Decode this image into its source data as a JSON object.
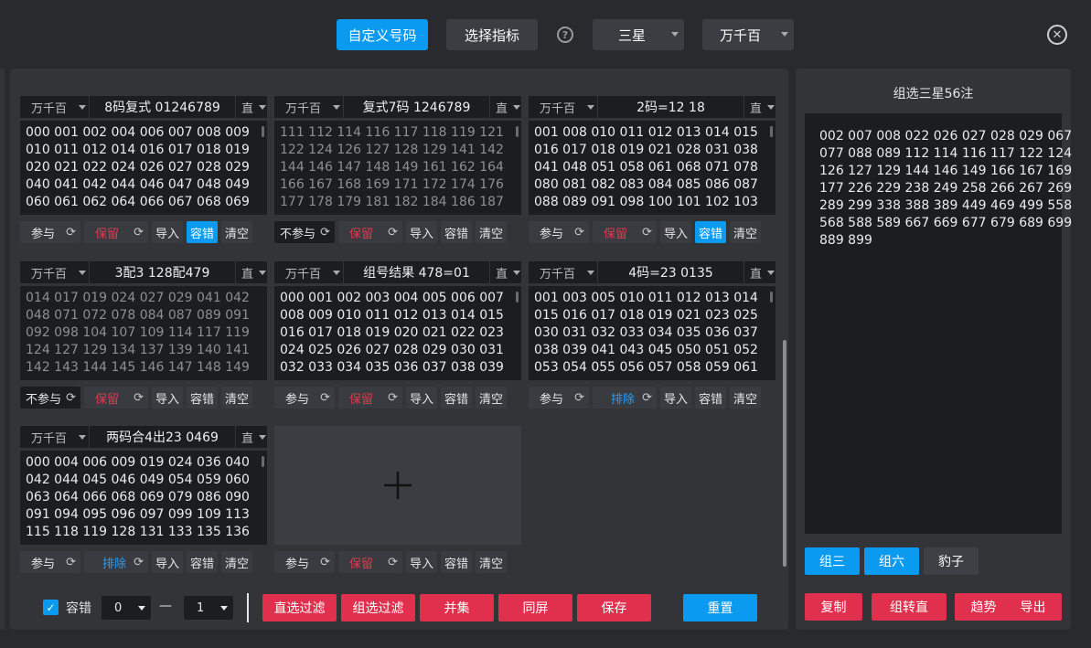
{
  "toolbar": {
    "custom_button": "自定义号码",
    "indicator_button": "选择指标",
    "help_icon": "?",
    "star_select": "三星",
    "position_select": "万千百"
  },
  "panels": [
    {
      "position": "万千百",
      "title": "8码复式 01246789",
      "mode": "直",
      "lines": [
        "000 001 002 004 006 007 008 009",
        "010 011 012 014 016 017 018 019",
        "020 021 022 024 026 027 028 029",
        "040 041 042 044 046 047 048 049",
        "060 061 062 064 066 067 068 069"
      ],
      "participate": "参与",
      "keep": "保留",
      "import": "导入",
      "tolerance": "容错",
      "clear": "清空"
    },
    {
      "position": "万千百",
      "title": "复式7码 1246789",
      "mode": "直",
      "lines": [
        "111 112 114 116 117 118 119 121",
        "122 124 126 127 128 129 141 142",
        "144 146 147 148 149 161 162 164",
        "166 167 168 169 171 172 174 176",
        "177 178 179 181 182 184 186 187"
      ],
      "participate": "不参与",
      "keep": "保留",
      "import": "导入",
      "tolerance": "容错",
      "clear": "清空"
    },
    {
      "position": "万千百",
      "title": "2码=12 18",
      "mode": "直",
      "lines": [
        "001 008 010 011 012 013 014 015",
        "016 017 018 019 021 028 031 038",
        "041 048 051 058 061 068 071 078",
        "080 081 082 083 084 085 086 087",
        "088 089 091 098 100 101 102 103"
      ],
      "participate": "参与",
      "keep": "保留",
      "import": "导入",
      "tolerance": "容错",
      "clear": "清空"
    },
    {
      "position": "万千百",
      "title": "3配3 128配479",
      "mode": "直",
      "lines": [
        "014 017 019 024 027 029 041 042",
        "048 071 072 078 084 087 089 091",
        "092 098 104 107 109 114 117 119",
        "124 127 129 134 137 139 140 141",
        "142 143 144 145 146 147 148 149"
      ],
      "participate": "不参与",
      "keep": "保留",
      "import": "导入",
      "tolerance": "容错",
      "clear": "清空"
    },
    {
      "position": "万千百",
      "title": "组号结果 478=01",
      "mode": "直",
      "lines": [
        "000 001 002 003 004 005 006 007",
        "008 009 010 011 012 013 014 015",
        "016 017 018 019 020 021 022 023",
        "024 025 026 027 028 029 030 031",
        "032 033 034 035 036 037 038 039"
      ],
      "participate": "参与",
      "keep": "保留",
      "import": "导入",
      "tolerance": "容错",
      "clear": "清空"
    },
    {
      "position": "万千百",
      "title": "4码=23 0135",
      "mode": "直",
      "lines": [
        "001 003 005 010 011 012 013 014",
        "015 016 017 018 019 021 023 025",
        "030 031 032 033 034 035 036 037",
        "038 039 041 043 045 050 051 052",
        "053 054 055 056 057 058 059 061"
      ],
      "participate": "参与",
      "keep": "排除",
      "import": "导入",
      "tolerance": "容错",
      "clear": "清空"
    },
    {
      "position": "万千百",
      "title": "两码合4出23 0469",
      "mode": "直",
      "lines": [
        "000 004 006 009 019 024 036 040",
        "042 044 045 046 049 054 059 060",
        "063 064 066 068 069 079 086 090",
        "091 094 095 096 097 099 109 113",
        "115 118 119 128 131 133 135 136"
      ],
      "participate": "参与",
      "keep": "排除",
      "import": "导入",
      "tolerance": "容错",
      "clear": "清空"
    }
  ],
  "add_panel": {
    "icon": "+",
    "participate": "参与",
    "keep": "保留",
    "import": "导入",
    "tolerance": "容错",
    "clear": "清空"
  },
  "bottom": {
    "tolerance_label": "容错",
    "min_value": "0",
    "dash": "—",
    "max_value": "1",
    "direct_filter": "直选过滤",
    "group_filter": "组选过滤",
    "union": "并集",
    "same_screen": "同屏",
    "save": "保存",
    "reset": "重置"
  },
  "side": {
    "title": "组选三星56注",
    "result_lines": [
      "002 007 008 022 026 027 028 029 067",
      "077 088 089 112 114 116 117 122 124",
      "126 127 129 144 146 149 166 167 169",
      "177 226 229 238 249 258 266 267 269",
      "289 299 338 388 389 449 469 499 558",
      "568 588 589 667 669 677 679 689 699",
      "889 899"
    ],
    "tab_group3": "组三",
    "tab_group6": "组六",
    "tab_leopard": "豹子",
    "copy": "复制",
    "to_direct": "组转直",
    "trend": "趋势",
    "export": "导出"
  },
  "colors": {
    "accent": "#0a9af0",
    "danger": "#e0304e",
    "background": "#292a2e",
    "panel": "#333438"
  }
}
